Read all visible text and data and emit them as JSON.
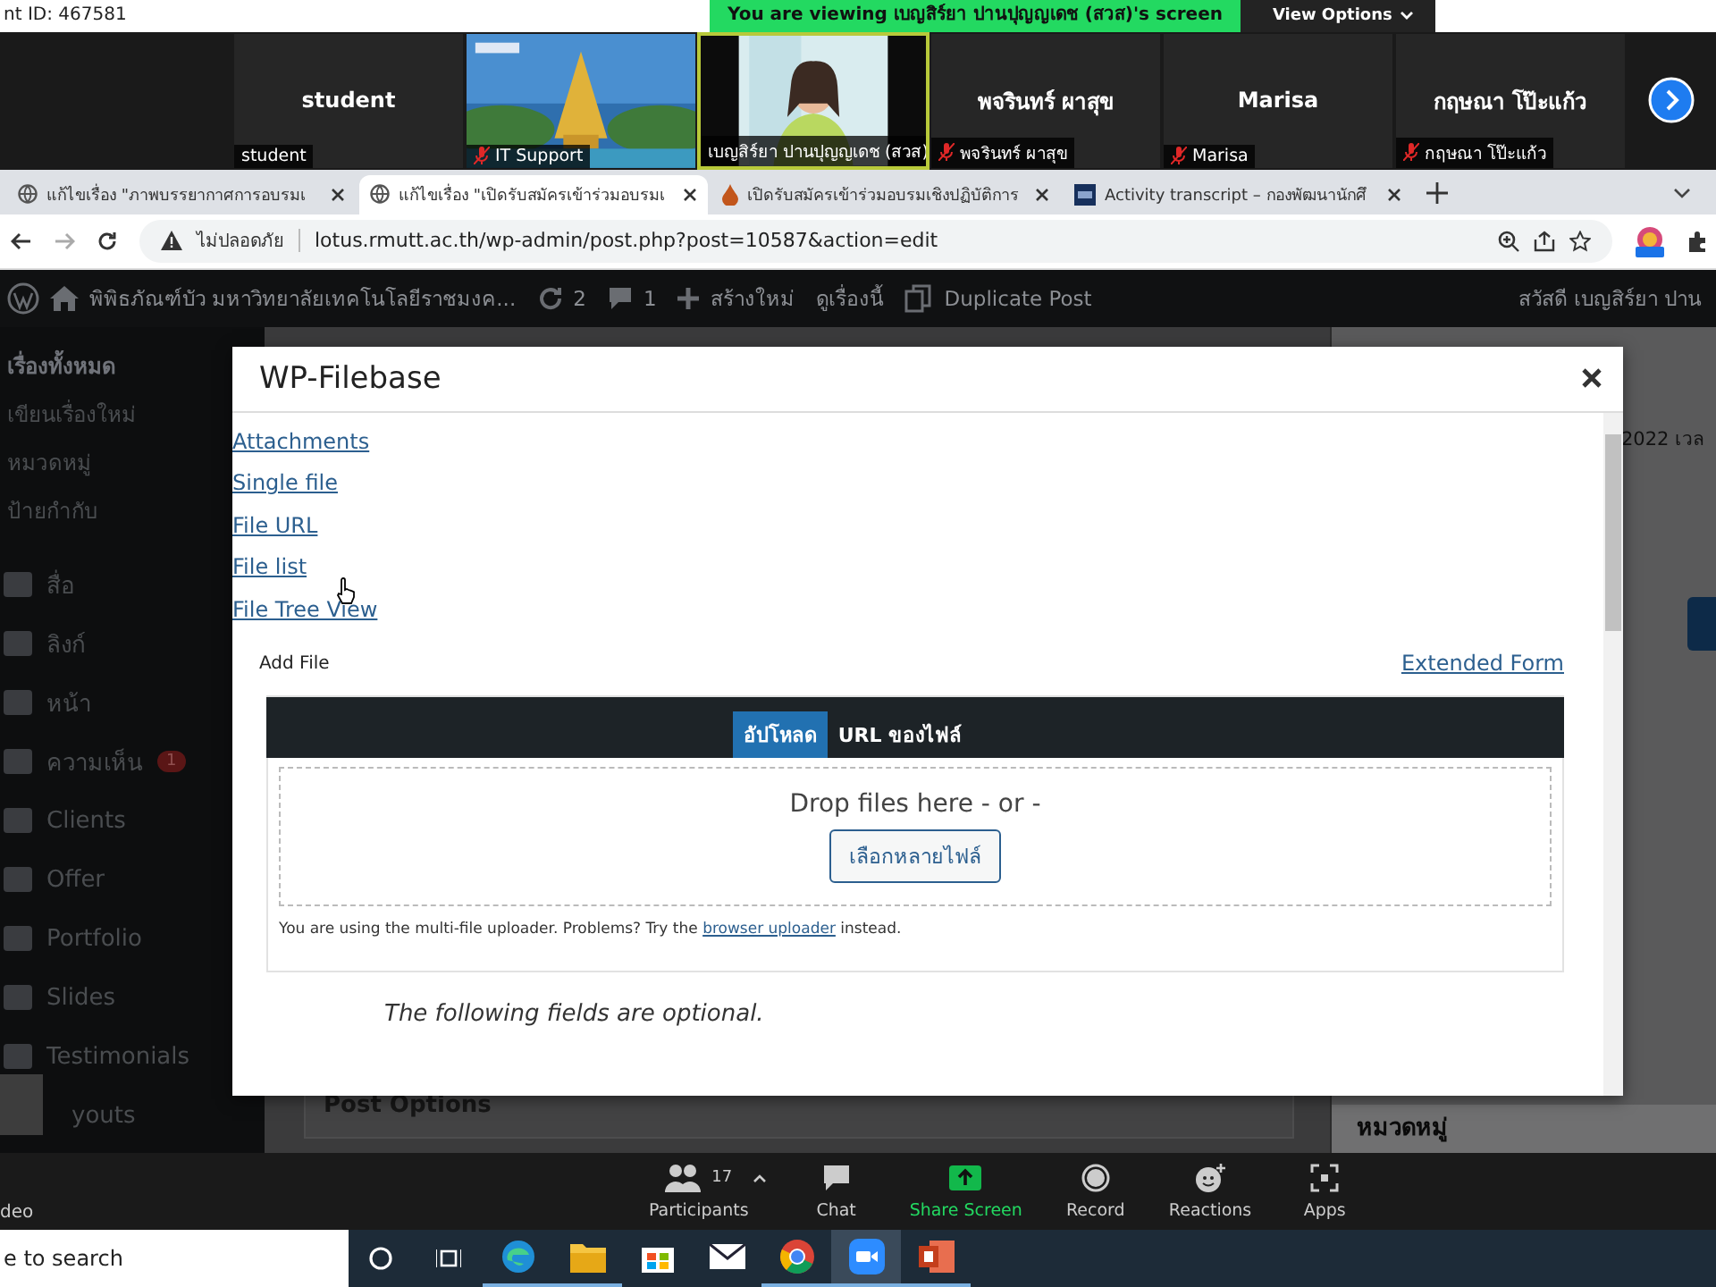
{
  "meeting_bar": {
    "meeting_id": "nt ID: 467581",
    "banner": "You are viewing เบญสิร์ยา ปานปุญญเดช (สวส)'s screen",
    "view_options": "View Options"
  },
  "gallery": [
    {
      "kind": "name",
      "name": "student",
      "label": "student",
      "muted": false,
      "speaking": false
    },
    {
      "kind": "picture",
      "label": "IT Support",
      "muted": true,
      "speaking": false
    },
    {
      "kind": "video",
      "label": "เบญสิร์ยา ปานปุญญเดช (สวส)",
      "muted": false,
      "speaking": true
    },
    {
      "kind": "name",
      "name": "พจรินทร์ ผาสุข",
      "label": "พจรินทร์ ผาสุข",
      "muted": true,
      "speaking": false
    },
    {
      "kind": "name",
      "name": "Marisa",
      "label": "Marisa",
      "muted": true,
      "speaking": false
    },
    {
      "kind": "name",
      "name": "กฤษณา โป๊ะแก้ว",
      "label": "กฤษณา โป๊ะแก้ว",
      "muted": true,
      "speaking": false
    }
  ],
  "browser_tabs": [
    {
      "title": "แก้ไขเรื่อง \"ภาพบรรยากาศการอบรมเ",
      "kind": "globe",
      "selected": false
    },
    {
      "title": "แก้ไขเรื่อง \"เปิดรับสมัครเข้าร่วมอบรมเ",
      "kind": "globe",
      "selected": true
    },
    {
      "title": "เปิดรับสมัครเข้าร่วมอบรมเชิงปฏิบัติการ",
      "kind": "drop",
      "selected": false
    },
    {
      "title": "Activity transcript – กองพัฒนานักศึ",
      "kind": "logo",
      "selected": false
    }
  ],
  "address_bar": {
    "security": "ไม่ปลอดภัย",
    "url": "lotus.rmutt.ac.th/wp-admin/post.php?post=10587&action=edit"
  },
  "admin_bar": {
    "site": "พิพิธภัณฑ์บัว มหาวิทยาลัยเทคโนโลยีราชมงค...",
    "updates": "2",
    "comments": "1",
    "new": "สร้างใหม่",
    "view": "ดูเรื่องนี้",
    "duplicate": "Duplicate Post",
    "greeting": "สวัสดี เบญสิร์ยา ปาน"
  },
  "sidebar": [
    {
      "kind": "sub",
      "label": "เรื่องทั้งหมด",
      "selected": true
    },
    {
      "kind": "sub",
      "label": "เขียนเรื่องใหม่",
      "selected": false
    },
    {
      "kind": "sub",
      "label": "หมวดหมู่",
      "selected": false
    },
    {
      "kind": "sub",
      "label": "ป้ายกำกับ",
      "selected": false
    },
    {
      "kind": "menu",
      "label": "สื่อ",
      "selected": false
    },
    {
      "kind": "menu",
      "label": "ลิงก์",
      "selected": false
    },
    {
      "kind": "menu",
      "label": "หน้า",
      "selected": false
    },
    {
      "kind": "menu",
      "label": "ความเห็น",
      "badge": "1",
      "selected": false
    },
    {
      "kind": "menu",
      "label": "Clients",
      "selected": false
    },
    {
      "kind": "menu",
      "label": "Offer",
      "selected": false
    },
    {
      "kind": "menu",
      "label": "Portfolio",
      "selected": false
    },
    {
      "kind": "menu",
      "label": "Slides",
      "selected": false
    },
    {
      "kind": "menu",
      "label": "Testimonials",
      "selected": false
    },
    {
      "kind": "menu",
      "label": "youts",
      "selected": false
    }
  ],
  "page_behind": {
    "date_fragment": "2022 เวล",
    "post_options": "Post Options",
    "categories": "หมวดหมู่"
  },
  "modal": {
    "title": "WP-Filebase",
    "links": [
      "Attachments",
      "Single file",
      "File URL",
      "File list",
      "File Tree View"
    ],
    "add_file": "Add File",
    "extended_form": "Extended Form",
    "upload_tabs": [
      {
        "label": "อัปโหลด",
        "selected": true
      },
      {
        "label": "URL ของไฟล์",
        "selected": false
      }
    ],
    "drop_text": "Drop files here - or -",
    "select_button": "เลือกหลายไฟล์",
    "note": {
      "before": "You are using the multi-file uploader. Problems? Try the",
      "link": "browser uploader",
      "after": "instead."
    },
    "optional_note": "The following fields are optional."
  },
  "zoom_toolbar": {
    "video_fragment": "deo",
    "participants_count": "17",
    "buttons": [
      {
        "label": "Participants",
        "kind": "normal"
      },
      {
        "label": "Chat",
        "kind": "normal"
      },
      {
        "label": "Share Screen",
        "kind": "share"
      },
      {
        "label": "Record",
        "kind": "normal"
      },
      {
        "label": "Reactions",
        "kind": "normal"
      },
      {
        "label": "Apps",
        "kind": "normal"
      }
    ]
  },
  "taskbar": {
    "search": {
      "placeholder": "e to search"
    },
    "apps": [
      {
        "open": true,
        "active": false
      },
      {
        "open": true,
        "active": false
      },
      {
        "open": false,
        "active": false
      },
      {
        "open": false,
        "active": false
      },
      {
        "open": true,
        "active": false
      },
      {
        "open": true,
        "active": true
      },
      {
        "open": true,
        "active": false
      }
    ]
  }
}
